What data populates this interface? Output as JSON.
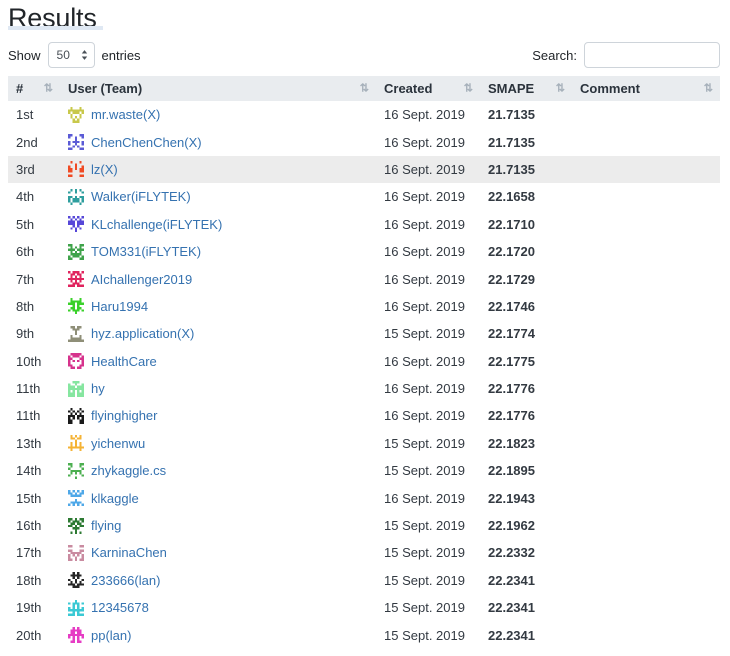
{
  "page_title": "Results",
  "controls": {
    "show_label": "Show",
    "entries_label": "entries",
    "page_length": "50",
    "search_label": "Search:",
    "search_value": "",
    "search_placeholder": ""
  },
  "table": {
    "headers": {
      "rank": "#",
      "user": "User (Team)",
      "created": "Created",
      "smape": "SMAPE",
      "comment": "Comment"
    },
    "sort_icon": "sort-both-icon",
    "rows": [
      {
        "rank": "1st",
        "user": "mr.waste",
        "team": "(X)",
        "created": "16 Sept. 2019",
        "smape": "21.7135",
        "comment": "",
        "avatar": "#c8c84b",
        "seed": 11,
        "highlight": false
      },
      {
        "rank": "2nd",
        "user": "ChenChenChen",
        "team": "(X)",
        "created": "16 Sept. 2019",
        "smape": "21.7135",
        "comment": "",
        "avatar": "#5b5bd6",
        "seed": 27,
        "highlight": false
      },
      {
        "rank": "3rd",
        "user": "lz",
        "team": "(X)",
        "created": "16 Sept. 2019",
        "smape": "21.7135",
        "comment": "",
        "avatar": "#f04a23",
        "seed": 5,
        "highlight": true
      },
      {
        "rank": "4th",
        "user": "Walker",
        "team": "(iFLYTEK)",
        "created": "16 Sept. 2019",
        "smape": "22.1658",
        "comment": "",
        "avatar": "#2e9e9e",
        "seed": 41,
        "highlight": false
      },
      {
        "rank": "5th",
        "user": "KLchallenge",
        "team": "(iFLYTEK)",
        "created": "16 Sept. 2019",
        "smape": "22.1710",
        "comment": "",
        "avatar": "#5647d8",
        "seed": 19,
        "highlight": false
      },
      {
        "rank": "6th",
        "user": "TOM331",
        "team": "(iFLYTEK)",
        "created": "16 Sept. 2019",
        "smape": "22.1720",
        "comment": "",
        "avatar": "#3fa34a",
        "seed": 33,
        "highlight": false
      },
      {
        "rank": "7th",
        "user": "AIchallenger2019",
        "team": "",
        "created": "16 Sept. 2019",
        "smape": "22.1729",
        "comment": "",
        "avatar": "#e0245e",
        "seed": 7,
        "highlight": false
      },
      {
        "rank": "8th",
        "user": "Haru1994",
        "team": "",
        "created": "16 Sept. 2019",
        "smape": "22.1746",
        "comment": "",
        "avatar": "#3ad12a",
        "seed": 52,
        "highlight": false
      },
      {
        "rank": "9th",
        "user": "hyz.application",
        "team": "(X)",
        "created": "15 Sept. 2019",
        "smape": "22.1774",
        "comment": "",
        "avatar": "#8f8f78",
        "seed": 61,
        "highlight": false
      },
      {
        "rank": "10th",
        "user": "HealthCare",
        "team": "",
        "created": "16 Sept. 2019",
        "smape": "22.1775",
        "comment": "",
        "avatar": "#d6338c",
        "seed": 14,
        "highlight": false
      },
      {
        "rank": "11th",
        "user": "hy",
        "team": "",
        "created": "16 Sept. 2019",
        "smape": "22.1776",
        "comment": "",
        "avatar": "#86e6a0",
        "seed": 23,
        "highlight": false
      },
      {
        "rank": "11th",
        "user": "flyinghigher",
        "team": "",
        "created": "16 Sept. 2019",
        "smape": "22.1776",
        "comment": "",
        "avatar": "#1a1a1a",
        "seed": 38,
        "highlight": false
      },
      {
        "rank": "13th",
        "user": "yichenwu",
        "team": "",
        "created": "15 Sept. 2019",
        "smape": "22.1823",
        "comment": "",
        "avatar": "#f5b335",
        "seed": 46,
        "highlight": false
      },
      {
        "rank": "14th",
        "user": "zhykaggle.cs",
        "team": "",
        "created": "15 Sept. 2019",
        "smape": "22.1895",
        "comment": "",
        "avatar": "#4caf50",
        "seed": 9,
        "highlight": false
      },
      {
        "rank": "15th",
        "user": "klkaggle",
        "team": "",
        "created": "16 Sept. 2019",
        "smape": "22.1943",
        "comment": "",
        "avatar": "#4fa8e8",
        "seed": 57,
        "highlight": false
      },
      {
        "rank": "16th",
        "user": "flying",
        "team": "",
        "created": "15 Sept. 2019",
        "smape": "22.1962",
        "comment": "",
        "avatar": "#2d7a33",
        "seed": 30,
        "highlight": false
      },
      {
        "rank": "17th",
        "user": "KarninaChen",
        "team": "",
        "created": "15 Sept. 2019",
        "smape": "22.2332",
        "comment": "",
        "avatar": "#c98ba0",
        "seed": 63,
        "highlight": false
      },
      {
        "rank": "18th",
        "user": "233666",
        "team": "(lan)",
        "created": "15 Sept. 2019",
        "smape": "22.2341",
        "comment": "",
        "avatar": "#262626",
        "seed": 17,
        "highlight": false
      },
      {
        "rank": "19th",
        "user": "12345678",
        "team": "",
        "created": "15 Sept. 2019",
        "smape": "22.2341",
        "comment": "",
        "avatar": "#3bc9d4",
        "seed": 44,
        "highlight": false
      },
      {
        "rank": "20th",
        "user": "pp",
        "team": "(lan)",
        "created": "15 Sept. 2019",
        "smape": "22.2341",
        "comment": "",
        "avatar": "#e63cc4",
        "seed": 50,
        "highlight": false
      }
    ]
  }
}
